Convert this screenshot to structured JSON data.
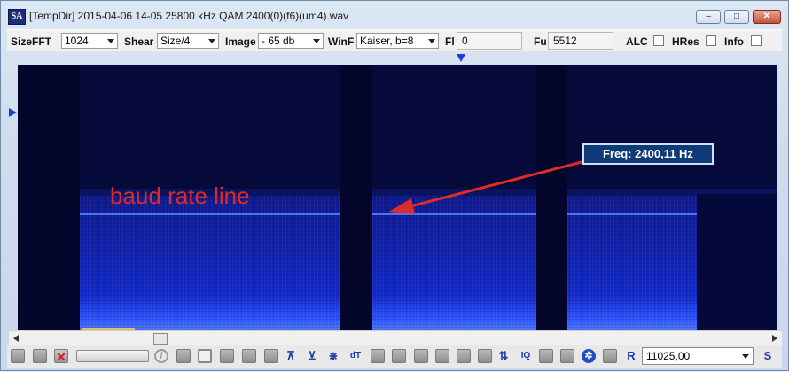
{
  "window": {
    "title": "[TempDir] 2015-04-06 14-05 25800 kHz QAM 2400(0)(f6)(um4).wav",
    "app_icon": "SA",
    "minimize_glyph": "–",
    "maximize_glyph": "□",
    "close_glyph": "✕"
  },
  "toolbar": {
    "sizefft_label": "SizeFFT",
    "sizefft_value": "1024",
    "shear_label": "Shear",
    "shear_value": "Size/4",
    "image_label": "Image",
    "image_value": "- 65 db",
    "winf_label": "WinF",
    "winf_value": "Kaiser, b=8",
    "fl_label": "Fl",
    "fl_value": "0",
    "fu_label": "Fu",
    "fu_value": "5512",
    "alc_label": "ALC",
    "alc_checked": false,
    "hres_label": "HRes",
    "hres_checked": false,
    "info_label": "Info",
    "info_checked": false
  },
  "spectrogram": {
    "annotation_text": "baud rate line",
    "freq_readout": "Freq: 2400,11 Hz",
    "arrow_color": "#e02a2a"
  },
  "bottom_bar": {
    "dt_label": "dT",
    "iq_label": "IQ",
    "r_label": "R",
    "s_label": "S",
    "sample_rate_value": "11025,00"
  }
}
